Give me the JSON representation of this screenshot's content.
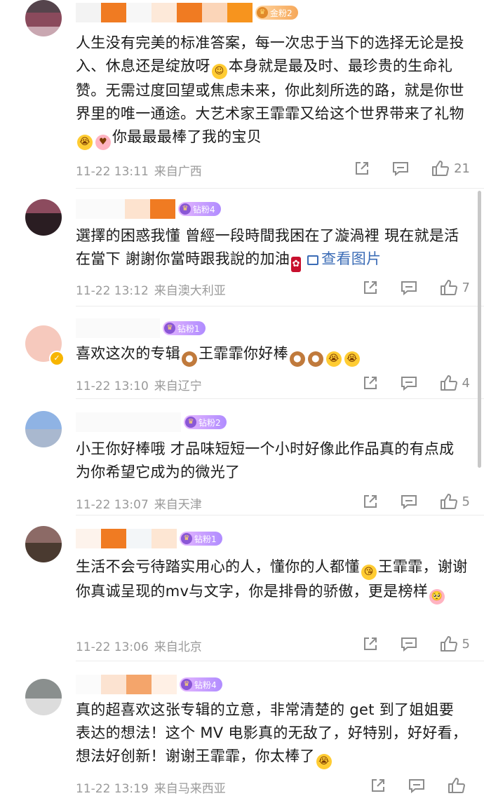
{
  "comments": [
    {
      "fan_label": "金粉2",
      "text": "人生没有完美的标准答案，每一次忠于当下的选择无论是投入、休息还是绽放呀",
      "text_tail": "本身就是最及时、最珍贵的生命礼赞。无需过度回望或焦虑未来，你此刻所选的路，就是你世界里的唯一通途。大艺术家王霏霏又给这个世界带来了礼物",
      "text_tail2": "你最最最棒了我的宝贝",
      "date": "11-22 13:11",
      "location": "来自广西",
      "likes": "21"
    },
    {
      "fan_label": "钻粉4",
      "text": "選擇的困惑我懂 曾經一段時間我困在了漩渦裡 現在就是活在當下 謝謝你當時跟我說的加油",
      "view_pic": "查看图片",
      "date": "11-22 13:12",
      "location": "来自澳大利亚",
      "likes": "7"
    },
    {
      "fan_label": "钻粉1",
      "text": "喜欢这次的专辑",
      "text_tail": "王霏霏你好棒",
      "date": "11-22 13:10",
      "location": "来自辽宁",
      "likes": "4"
    },
    {
      "fan_label": "钻粉2",
      "text": "小王你好棒哦 才品味短短一个小时好像此作品真的有点成为你希望它成为的微光了",
      "date": "11-22 13:07",
      "location": "来自天津",
      "likes": "5"
    },
    {
      "fan_label": "钻粉1",
      "text": "生活不会亏待踏实用心的人，懂你的人都懂",
      "text_tail": "王霏霏，谢谢你真诚呈现的mv与文字，你是排骨的骄傲，更是榜样",
      "date": "11-22 13:06",
      "location": "来自北京",
      "likes": "5"
    },
    {
      "fan_label": "钻粉4",
      "text": "真的超喜欢这张专辑的立意，非常清楚的 get 到了姐姐要表达的想法！这个 MV 电影真的无敌了，好特别，好好看，想法好创新！谢谢王霏霏，你太棒了",
      "date": "11-22 13:19",
      "location": "来自马来西亚",
      "likes": ""
    }
  ],
  "icons": {
    "share": "share-icon",
    "reply": "comment-icon",
    "like": "thumbs-up-icon",
    "fan": "crown-icon",
    "verified": "verified-badge-icon"
  },
  "colors": {
    "link": "#3b6cb6",
    "meta": "#9a9a9a",
    "fan_badge": "#b08cff"
  }
}
